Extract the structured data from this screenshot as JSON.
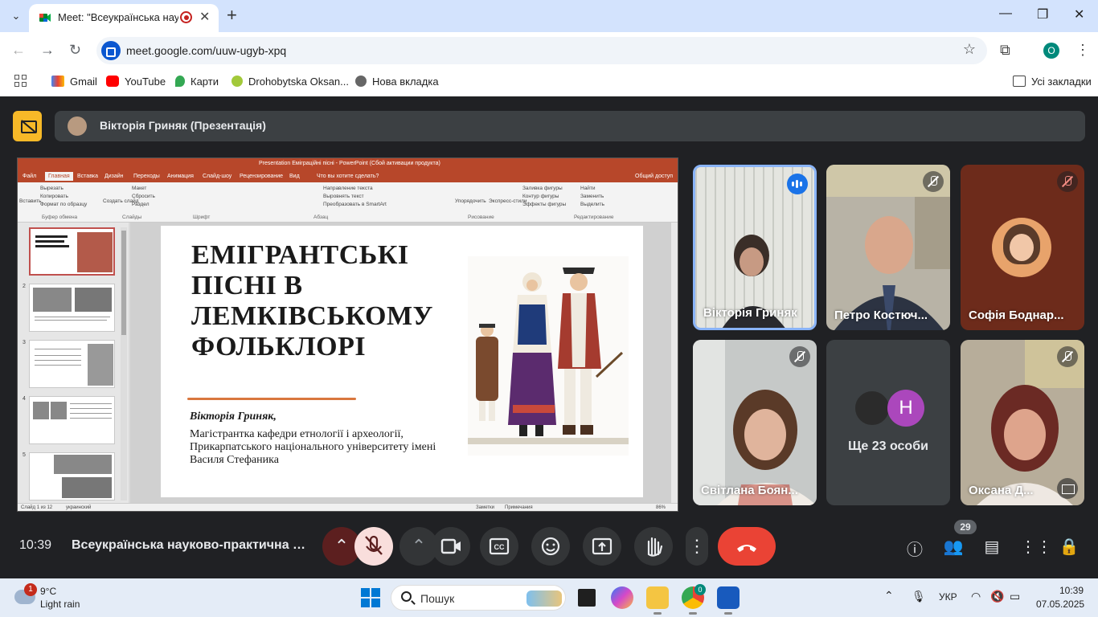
{
  "browser": {
    "tab_title": "Meet: \"Всеукраїнська науко",
    "url": "meet.google.com/uuw-ugyb-xpq",
    "profile_initial": "O",
    "bookmarks": [
      "Gmail",
      "YouTube",
      "Карти",
      "Drohobytska Oksan...",
      "Нова вкладка"
    ],
    "all_bookmarks": "Усі закладки"
  },
  "meet": {
    "presenter_banner": "Вікторія Гриняк (Презентація)",
    "clock": "10:39",
    "meeting_name": "Всеукраїнська науково-практична к...",
    "participants_count": "29",
    "participants": [
      {
        "name": "Вікторія Гриняк",
        "state": "speaking"
      },
      {
        "name": "Петро Костюч...",
        "state": "muted"
      },
      {
        "name": "Софія Боднар...",
        "state": "muted"
      },
      {
        "name": "Світлана Боян...",
        "state": "muted"
      },
      {
        "name": "Ще 23 особи",
        "initial": "Н"
      },
      {
        "name": "Оксана Д...",
        "state": "muted"
      }
    ]
  },
  "powerpoint": {
    "window_title": "Presentation Еміграційні пісні - PowerPoint (Сбой активации продукта)",
    "tabs": [
      "Файл",
      "Главная",
      "Вставка",
      "Дизайн",
      "Переходы",
      "Анимация",
      "Слайд-шоу",
      "Рецензирование",
      "Вид",
      "Что вы хотите сделать?",
      "Общий доступ"
    ],
    "ribbon": {
      "cut": "Вырезать",
      "copy": "Копировать",
      "format": "Формат по образцу",
      "paste": "Вставить",
      "new_slide": "Создать слайд",
      "layout": "Макет",
      "reset": "Сбросить",
      "section": "Раздел",
      "text_dir": "Направление текста",
      "align": "Выровнять текст",
      "smartart": "Преобразовать в SmartArt",
      "arrange": "Упорядочить",
      "quick_styles": "Экспресс-стили",
      "fill": "Заливка фигуры",
      "outline": "Контур фигуры",
      "effects": "Эффекты фигуры",
      "find": "Найти",
      "replace": "Заменить",
      "select": "Выделить",
      "groups": [
        "Буфер обмена",
        "Слайды",
        "Шрифт",
        "Абзац",
        "Рисование",
        "Редактирование"
      ]
    },
    "slide_numbers": [
      "2",
      "3",
      "4",
      "5"
    ],
    "status": {
      "slide": "Слайд 1 из 12",
      "lang": "украинский",
      "notes": "Заметки",
      "comments": "Примечания",
      "zoom": "86%"
    }
  },
  "slide": {
    "title_lines": [
      "ЕМІГРАНТСЬКІ",
      "ПІСНІ В",
      "ЛЕМКІВСЬКОМУ",
      "ФОЛЬКЛОРІ"
    ],
    "author": "Вікторія Гриняк,",
    "affiliation": "Магістрантка кафедри етнології і археології, Прикарпатського національного університету імені Василя Стефаника"
  },
  "taskbar": {
    "weather_badge": "1",
    "temperature": "9°C",
    "condition": "Light rain",
    "search": "Пошук",
    "chrome_badge": "0",
    "lang": "УКР",
    "time": "10:39",
    "date": "07.05.2025"
  },
  "colors": {
    "tab_strip": "#d3e3fd",
    "meet_bg": "#202124",
    "present_accent": "#f7b928",
    "leave": "#ea4335",
    "ppt_accent": "#b7472a",
    "active_speaker": "#8ab4f8"
  }
}
